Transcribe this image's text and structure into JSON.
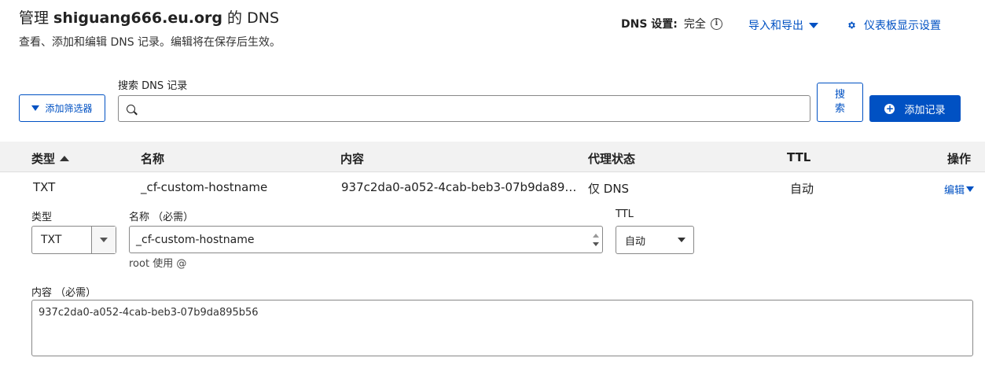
{
  "header": {
    "title_prefix": "管理 ",
    "domain": "shiguang666.eu.org",
    "title_suffix": " 的 DNS",
    "subtitle": "查看、添加和编辑 DNS 记录。编辑将在保存后生效。",
    "dns_setting_label": "DNS 设置:",
    "dns_setting_value": "完全",
    "import_export": "导入和导出",
    "dashboard_settings": "仪表板显示设置"
  },
  "toolbar": {
    "filter_label": "添加筛选器",
    "search_label": "搜索 DNS 记录",
    "search_value": "",
    "search_button": "搜索",
    "add_record": "添加记录"
  },
  "table": {
    "columns": [
      "类型",
      "名称",
      "内容",
      "代理状态",
      "TTL",
      "操作"
    ],
    "sort_column": "类型",
    "sort_direction": "asc",
    "rows": [
      {
        "type": "TXT",
        "name": "_cf-custom-hostname",
        "content": "937c2da0-a052-4cab-beb3-07b9da89…",
        "proxy": "仅 DNS",
        "ttl": "自动",
        "action": "编辑"
      }
    ]
  },
  "edit_form": {
    "type_label": "类型",
    "type_value": "TXT",
    "name_label": "名称 （必需）",
    "name_value": "_cf-custom-hostname",
    "name_helper": "root 使用 @",
    "ttl_label": "TTL",
    "ttl_value": "自动",
    "content_label": "内容 （必需）",
    "content_value": "937c2da0-a052-4cab-beb3-07b9da895b56"
  },
  "icons": {
    "info": "info-icon",
    "import_caret": "chevron-down-icon",
    "gear": "gear-icon",
    "filter": "filter-icon",
    "search": "search-icon",
    "add": "plus-circle-icon",
    "sort": "sort-ascending-icon"
  },
  "colors": {
    "accent": "#0051c3",
    "header_bg": "#f2f2f2"
  }
}
